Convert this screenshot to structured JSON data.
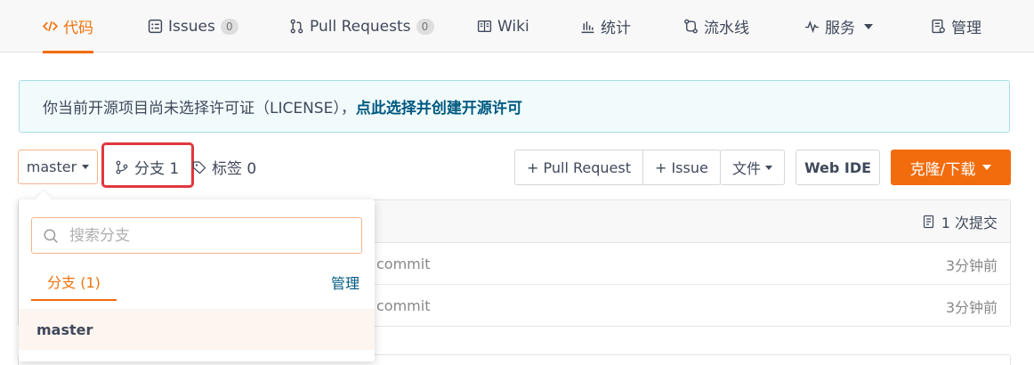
{
  "nav": {
    "tabs": [
      {
        "label": "代码",
        "icon": "code-icon",
        "active": true
      },
      {
        "label": "Issues",
        "icon": "issues-icon",
        "count": "0"
      },
      {
        "label": "Pull Requests",
        "icon": "pull-request-icon",
        "count": "0"
      },
      {
        "label": "Wiki",
        "icon": "book-icon"
      },
      {
        "label": "统计",
        "icon": "bar-chart-icon"
      },
      {
        "label": "流水线",
        "icon": "pipeline-icon"
      },
      {
        "label": "服务",
        "icon": "pulse-icon",
        "dropdown": true
      },
      {
        "label": "管理",
        "icon": "settings-doc-icon"
      }
    ]
  },
  "notice": {
    "text": "你当前开源项目尚未选择许可证（LICENSE），",
    "link": "点此选择并创建开源许可"
  },
  "toolbar": {
    "branch": "master",
    "branches_label": "分支 1",
    "tags_label": "标签 0",
    "pull_request": "+ Pull Request",
    "issue": "+ Issue",
    "file": "文件",
    "web_ide": "Web IDE",
    "clone": "克隆/下载"
  },
  "file_list": {
    "commits_label": "1 次提交",
    "rows": [
      {
        "message": "commit",
        "time": "3分钟前"
      },
      {
        "message": "commit",
        "time": "3分钟前"
      }
    ]
  },
  "branch_dropdown": {
    "search_placeholder": "搜索分支",
    "tab_label": "分支 (1)",
    "manage_label": "管理",
    "items": [
      "master"
    ]
  },
  "colors": {
    "accent": "#f26c0e",
    "link": "#005980",
    "highlight_box": "#e0383e",
    "notice_bg": "#f1fbfc"
  }
}
